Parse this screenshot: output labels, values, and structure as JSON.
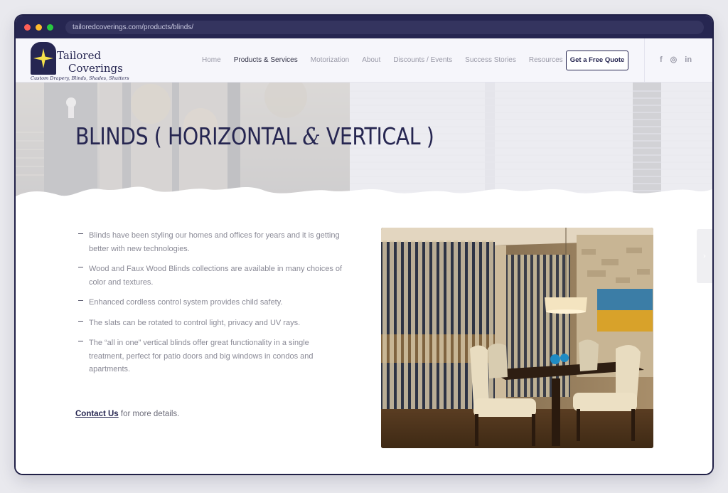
{
  "browser": {
    "url": "tailoredcoverings.com/products/blinds/"
  },
  "logo": {
    "line1": "Tailored",
    "line2": "Coverings",
    "tagline": "Custom Drapery, Blinds, Shades, Shutters"
  },
  "nav": {
    "items": [
      {
        "label": "Home",
        "active": false
      },
      {
        "label": "Products & Services",
        "active": true
      },
      {
        "label": "Motorization",
        "active": false
      },
      {
        "label": "About",
        "active": false
      },
      {
        "label": "Discounts / Events",
        "active": false
      },
      {
        "label": "Success Stories",
        "active": false
      },
      {
        "label": "Resources",
        "active": false
      }
    ],
    "cta_label": "Get a Free Quote"
  },
  "social": {
    "facebook": "f",
    "instagram": "◎",
    "linkedin": "in"
  },
  "hero": {
    "title_before": "BLINDS ( HORIZONTAL ",
    "title_amp": "&",
    "title_after": " VERTICAL )"
  },
  "content": {
    "bullets": [
      "Blinds have been styling our homes and offices for years and it is getting better with new technologies.",
      "Wood and Faux Wood Blinds collections are available in many choices of color and textures.",
      "Enhanced cordless control system provides child safety.",
      "The slats can be rotated to control light, privacy and UV rays.",
      "The “all in one” vertical blinds offer great functionality in a single treatment, perfect for patio doors and big windows in condos and apartments."
    ],
    "contact_link": "Contact Us",
    "contact_rest": " for more details."
  },
  "side_tab": {
    "arrow": "›"
  },
  "colors": {
    "brand_navy": "#262651",
    "logo_star": "#f5e14b",
    "header_bg": "#f6f6fb"
  }
}
